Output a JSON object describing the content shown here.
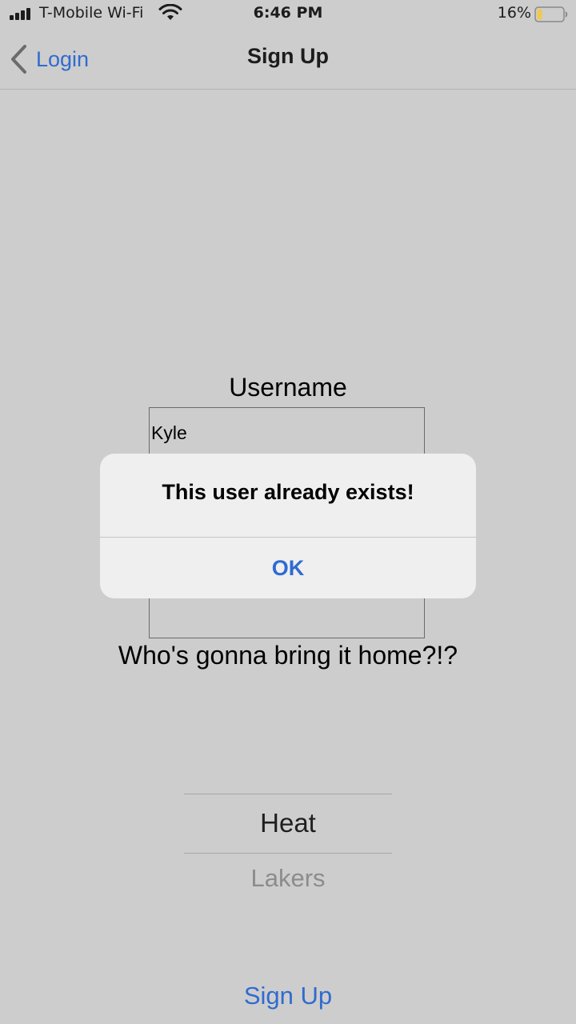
{
  "status_bar": {
    "carrier": "T-Mobile Wi-Fi",
    "time": "6:46 PM",
    "battery_percent": "16%",
    "icons": [
      "signal-icon",
      "wifi-icon",
      "battery-icon"
    ]
  },
  "nav": {
    "back_label": "Login",
    "title": "Sign Up",
    "back_icon": "chevron-left-icon"
  },
  "form": {
    "username_label": "Username",
    "username_value": "Kyle",
    "prompt": "Who's gonna bring it home?!?"
  },
  "picker": {
    "selected": "Heat",
    "next": "Lakers"
  },
  "signup_button": "Sign Up",
  "alert": {
    "title": "This user already exists!",
    "ok_label": "OK"
  },
  "colors": {
    "accent": "#2f6bd0",
    "background": "#cdcdcd",
    "alert_background": "#efefef",
    "battery_fill": "#f2c94c"
  }
}
